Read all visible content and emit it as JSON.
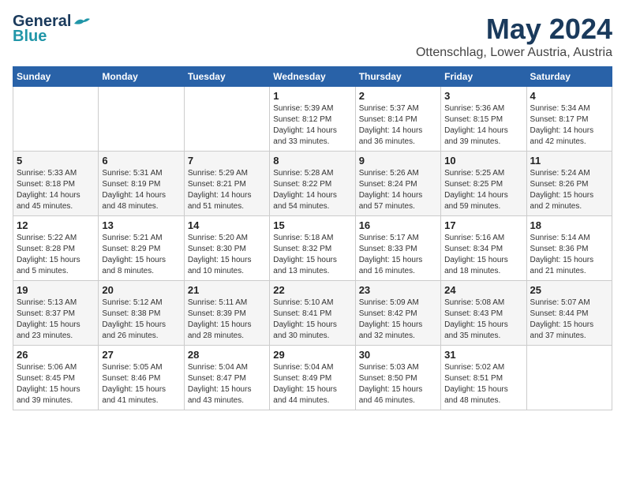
{
  "logo": {
    "text1": "General",
    "text2": "Blue"
  },
  "title": "May 2024",
  "location": "Ottenschlag, Lower Austria, Austria",
  "days_of_week": [
    "Sunday",
    "Monday",
    "Tuesday",
    "Wednesday",
    "Thursday",
    "Friday",
    "Saturday"
  ],
  "weeks": [
    [
      {
        "day": "",
        "info": ""
      },
      {
        "day": "",
        "info": ""
      },
      {
        "day": "",
        "info": ""
      },
      {
        "day": "1",
        "info": "Sunrise: 5:39 AM\nSunset: 8:12 PM\nDaylight: 14 hours\nand 33 minutes."
      },
      {
        "day": "2",
        "info": "Sunrise: 5:37 AM\nSunset: 8:14 PM\nDaylight: 14 hours\nand 36 minutes."
      },
      {
        "day": "3",
        "info": "Sunrise: 5:36 AM\nSunset: 8:15 PM\nDaylight: 14 hours\nand 39 minutes."
      },
      {
        "day": "4",
        "info": "Sunrise: 5:34 AM\nSunset: 8:17 PM\nDaylight: 14 hours\nand 42 minutes."
      }
    ],
    [
      {
        "day": "5",
        "info": "Sunrise: 5:33 AM\nSunset: 8:18 PM\nDaylight: 14 hours\nand 45 minutes."
      },
      {
        "day": "6",
        "info": "Sunrise: 5:31 AM\nSunset: 8:19 PM\nDaylight: 14 hours\nand 48 minutes."
      },
      {
        "day": "7",
        "info": "Sunrise: 5:29 AM\nSunset: 8:21 PM\nDaylight: 14 hours\nand 51 minutes."
      },
      {
        "day": "8",
        "info": "Sunrise: 5:28 AM\nSunset: 8:22 PM\nDaylight: 14 hours\nand 54 minutes."
      },
      {
        "day": "9",
        "info": "Sunrise: 5:26 AM\nSunset: 8:24 PM\nDaylight: 14 hours\nand 57 minutes."
      },
      {
        "day": "10",
        "info": "Sunrise: 5:25 AM\nSunset: 8:25 PM\nDaylight: 14 hours\nand 59 minutes."
      },
      {
        "day": "11",
        "info": "Sunrise: 5:24 AM\nSunset: 8:26 PM\nDaylight: 15 hours\nand 2 minutes."
      }
    ],
    [
      {
        "day": "12",
        "info": "Sunrise: 5:22 AM\nSunset: 8:28 PM\nDaylight: 15 hours\nand 5 minutes."
      },
      {
        "day": "13",
        "info": "Sunrise: 5:21 AM\nSunset: 8:29 PM\nDaylight: 15 hours\nand 8 minutes."
      },
      {
        "day": "14",
        "info": "Sunrise: 5:20 AM\nSunset: 8:30 PM\nDaylight: 15 hours\nand 10 minutes."
      },
      {
        "day": "15",
        "info": "Sunrise: 5:18 AM\nSunset: 8:32 PM\nDaylight: 15 hours\nand 13 minutes."
      },
      {
        "day": "16",
        "info": "Sunrise: 5:17 AM\nSunset: 8:33 PM\nDaylight: 15 hours\nand 16 minutes."
      },
      {
        "day": "17",
        "info": "Sunrise: 5:16 AM\nSunset: 8:34 PM\nDaylight: 15 hours\nand 18 minutes."
      },
      {
        "day": "18",
        "info": "Sunrise: 5:14 AM\nSunset: 8:36 PM\nDaylight: 15 hours\nand 21 minutes."
      }
    ],
    [
      {
        "day": "19",
        "info": "Sunrise: 5:13 AM\nSunset: 8:37 PM\nDaylight: 15 hours\nand 23 minutes."
      },
      {
        "day": "20",
        "info": "Sunrise: 5:12 AM\nSunset: 8:38 PM\nDaylight: 15 hours\nand 26 minutes."
      },
      {
        "day": "21",
        "info": "Sunrise: 5:11 AM\nSunset: 8:39 PM\nDaylight: 15 hours\nand 28 minutes."
      },
      {
        "day": "22",
        "info": "Sunrise: 5:10 AM\nSunset: 8:41 PM\nDaylight: 15 hours\nand 30 minutes."
      },
      {
        "day": "23",
        "info": "Sunrise: 5:09 AM\nSunset: 8:42 PM\nDaylight: 15 hours\nand 32 minutes."
      },
      {
        "day": "24",
        "info": "Sunrise: 5:08 AM\nSunset: 8:43 PM\nDaylight: 15 hours\nand 35 minutes."
      },
      {
        "day": "25",
        "info": "Sunrise: 5:07 AM\nSunset: 8:44 PM\nDaylight: 15 hours\nand 37 minutes."
      }
    ],
    [
      {
        "day": "26",
        "info": "Sunrise: 5:06 AM\nSunset: 8:45 PM\nDaylight: 15 hours\nand 39 minutes."
      },
      {
        "day": "27",
        "info": "Sunrise: 5:05 AM\nSunset: 8:46 PM\nDaylight: 15 hours\nand 41 minutes."
      },
      {
        "day": "28",
        "info": "Sunrise: 5:04 AM\nSunset: 8:47 PM\nDaylight: 15 hours\nand 43 minutes."
      },
      {
        "day": "29",
        "info": "Sunrise: 5:04 AM\nSunset: 8:49 PM\nDaylight: 15 hours\nand 44 minutes."
      },
      {
        "day": "30",
        "info": "Sunrise: 5:03 AM\nSunset: 8:50 PM\nDaylight: 15 hours\nand 46 minutes."
      },
      {
        "day": "31",
        "info": "Sunrise: 5:02 AM\nSunset: 8:51 PM\nDaylight: 15 hours\nand 48 minutes."
      },
      {
        "day": "",
        "info": ""
      }
    ]
  ]
}
